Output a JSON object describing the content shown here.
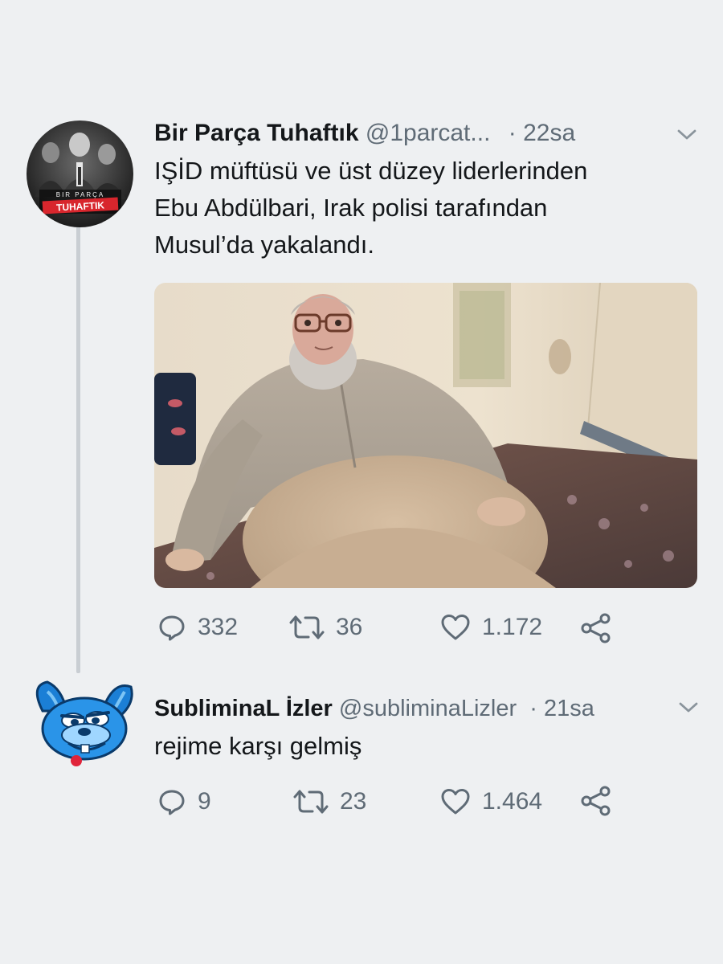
{
  "tweet1": {
    "display_name": "Bir Parça Tuhaftık",
    "handle": "@1parcat...",
    "dot": "·",
    "time": "22sa",
    "text_lines": [
      "IŞİD müftüsü ve üst düzey liderlerinden",
      "Ebu Abdülbari, Irak polisi tarafından",
      "Musul’da yakalandı."
    ],
    "avatar_logo_text": "BIR PARÇA TUHAFTIK",
    "replies": "332",
    "retweets": "36",
    "likes": "1.172"
  },
  "tweet2": {
    "display_name": "SubliminaL İzler",
    "handle": "@subliminaLizler",
    "dot": "·",
    "time": "21sa",
    "text": "rejime karşı gelmiş",
    "replies": "9",
    "retweets": "23",
    "likes": "1.464"
  },
  "icons": {
    "reply": "reply-icon",
    "retweet": "retweet-icon",
    "like": "heart-icon",
    "share": "share-icon",
    "caret": "chevron-down-icon"
  },
  "colors": {
    "background": "#eef0f2",
    "text": "#14171a",
    "muted": "#5f6b76",
    "thread_line": "#c9ced3",
    "logo_red": "#d8262d"
  }
}
